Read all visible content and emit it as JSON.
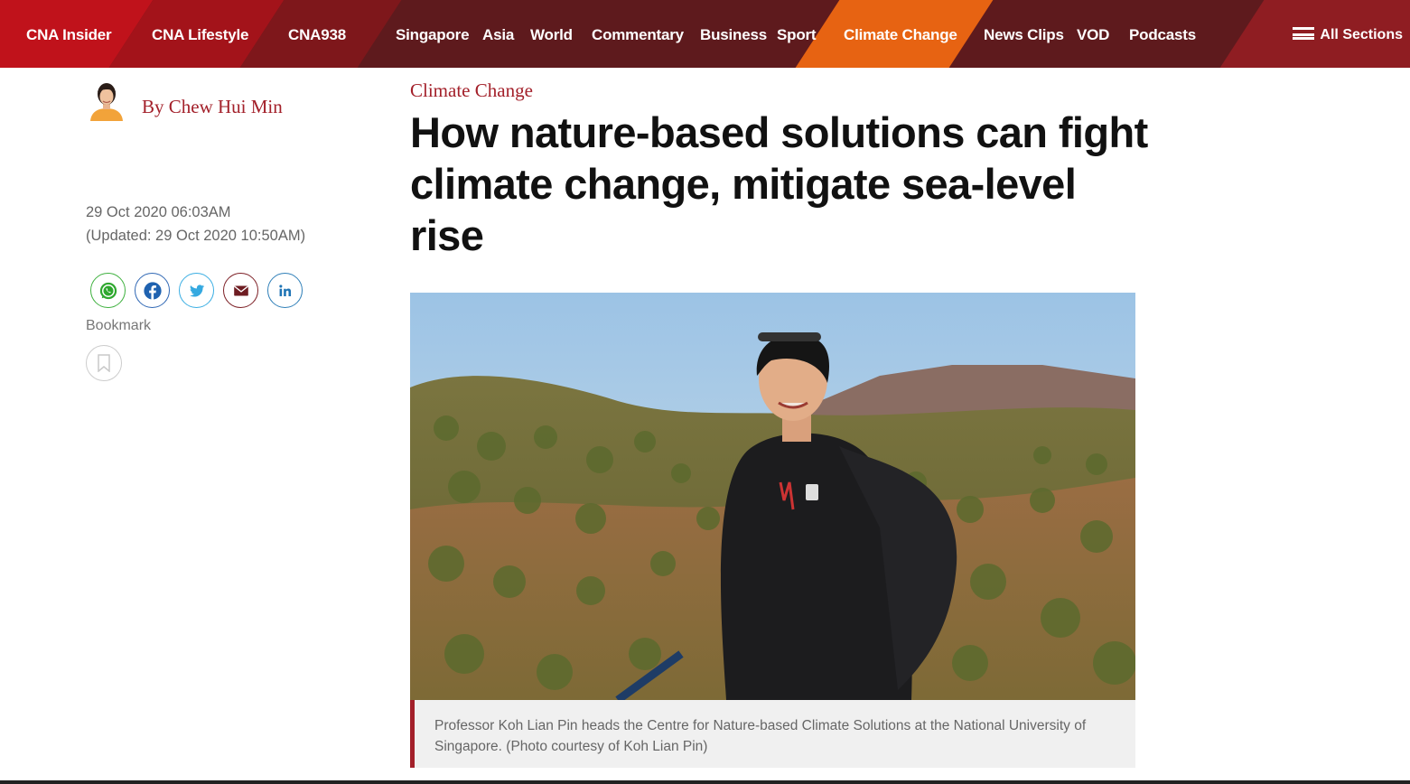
{
  "nav": {
    "brand_links": [
      {
        "label": "CNA Insider"
      },
      {
        "label": "CNA Lifestyle"
      },
      {
        "label": "CNA938"
      }
    ],
    "sections": [
      {
        "label": "Singapore"
      },
      {
        "label": "Asia"
      },
      {
        "label": "World"
      },
      {
        "label": "Commentary"
      },
      {
        "label": "Business"
      },
      {
        "label": "Sport"
      },
      {
        "label": "Climate Change",
        "active": true
      },
      {
        "label": "News Clips"
      },
      {
        "label": "VOD"
      },
      {
        "label": "Podcasts"
      }
    ],
    "all_sections_label": "All Sections",
    "all_sections_icon": "hamburger-icon"
  },
  "colors": {
    "nav_background": "#5e1a1d",
    "cna_insider": "#c0121b",
    "cna_lifestyle": "#a3131a",
    "cna938": "#7e171b",
    "active_section": "#e76312",
    "accent": "#a3202a"
  },
  "author": {
    "byline": "By Chew Hui Min"
  },
  "meta": {
    "published": "29 Oct 2020 06:03AM",
    "updated": "(Updated: 29 Oct 2020 10:50AM)"
  },
  "share": {
    "icons": [
      "whatsapp-icon",
      "facebook-icon",
      "twitter-icon",
      "email-icon",
      "linkedin-icon"
    ]
  },
  "bookmark": {
    "label": "Bookmark",
    "icon": "bookmark-icon"
  },
  "article": {
    "category": "Climate Change",
    "headline": "How nature-based solutions can fight climate change, mitigate sea-level rise",
    "caption": "Professor Koh Lian Pin heads the Centre for Nature-based Climate Solutions at the National University of Singapore. (Photo courtesy of Koh Lian Pin)"
  }
}
